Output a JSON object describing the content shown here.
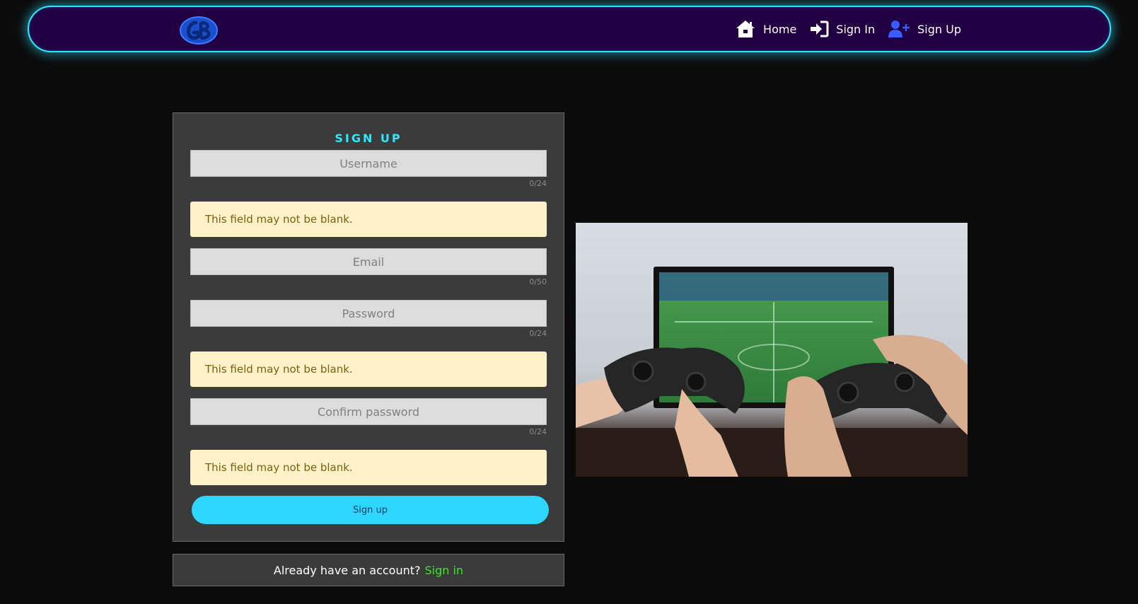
{
  "nav": {
    "logo_alt": "GB",
    "links": [
      {
        "label": "Home",
        "icon": "home-icon"
      },
      {
        "label": "Sign In",
        "icon": "sign-in-icon"
      },
      {
        "label": "Sign Up",
        "icon": "user-plus-icon"
      }
    ]
  },
  "form": {
    "title": "SIGN UP",
    "username": {
      "placeholder": "Username",
      "value": "",
      "counter": "0/24"
    },
    "email": {
      "placeholder": "Email",
      "value": "",
      "counter": "0/50"
    },
    "password": {
      "placeholder": "Password",
      "value": "",
      "counter": "0/24"
    },
    "confirm": {
      "placeholder": "Confirm password",
      "value": "",
      "counter": "0/24"
    },
    "errors": {
      "username": "This field may not be blank.",
      "password": "This field may not be blank.",
      "confirm": "This field may not be blank."
    },
    "submit_label": "Sign up"
  },
  "signin": {
    "prompt": "Already have an account?",
    "link_label": "Sign in"
  },
  "colors": {
    "accent_cyan": "#2ee8ff",
    "nav_bg": "#220044",
    "link_green": "#3ee81e",
    "button": "#2ed7ff",
    "alert_bg": "#fff2c9"
  }
}
